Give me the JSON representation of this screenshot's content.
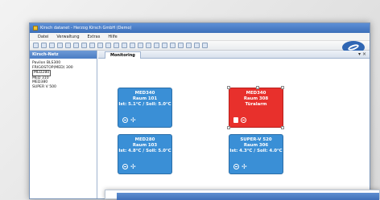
{
  "window": {
    "title": "Kirsch datanet - Herzog Kirsch GmbH (Demo)"
  },
  "menu": [
    "Datei",
    "Verwaltung",
    "Extras",
    "Hilfe"
  ],
  "sidebar": {
    "title": "Kirsch-Netz",
    "items": [
      "Pavilon BLS300",
      "FRIGOSTOP(MED) 300",
      "MED280",
      "MED 310",
      "MED380",
      "SUPER V 500"
    ]
  },
  "tab": {
    "label": "Monitoring"
  },
  "cards": [
    {
      "name": "MED340",
      "room": "Raum 101",
      "temps": "Ist: 5.1°C / Soll: 5.0°C",
      "alarm": false
    },
    {
      "name": "MED340",
      "room": "Raum 308",
      "temps": "Türalarm",
      "alarm": true
    },
    {
      "name": "MED280",
      "room": "Raum 103",
      "temps": "Ist: 4.8°C / Soll: 5.0°C",
      "alarm": false
    },
    {
      "name": "SUPER-V 520",
      "room": "Raum 306",
      "temps": "Ist: 4.3°C / Soll: 4.0°C",
      "alarm": false
    }
  ],
  "colors": {
    "card": "#3a8fd6",
    "alarm": "#e8302c",
    "title": "#3c6fb9"
  }
}
